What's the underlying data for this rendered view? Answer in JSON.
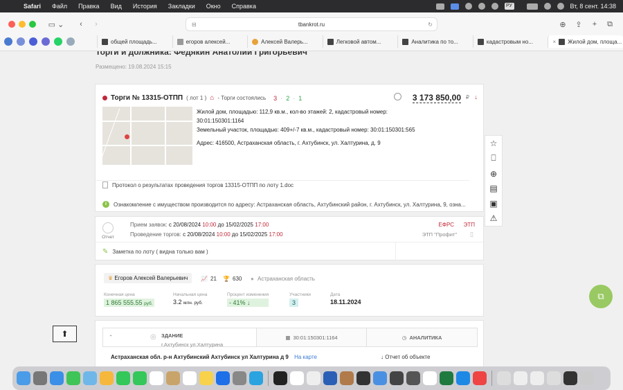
{
  "menubar": {
    "app": "Safari",
    "items": [
      "Файл",
      "Правка",
      "Вид",
      "История",
      "Закладки",
      "Окно",
      "Справка"
    ],
    "keyboard": "РУ",
    "datetime": "Вт, 8 сент.  14:38"
  },
  "browser": {
    "url": "tbankrot.ru",
    "tabs": [
      {
        "label": "общей площадь..."
      },
      {
        "label": "егоров алексей..."
      },
      {
        "label": "Алексей Валерь..."
      },
      {
        "label": "Легковой автом..."
      },
      {
        "label": "Аналитика по то..."
      },
      {
        "label": "кадастровым но..."
      },
      {
        "label": "Жилой дом, площа..."
      }
    ]
  },
  "page": {
    "title": "Торги и должника: Федякин Анатолий Григорьевич",
    "posted": "Размещено: 19.08.2024 15:15",
    "lot": {
      "number": "Торги № 13315-ОТПП",
      "lot_count": "( лот 1 )",
      "status": "- Торги состоялись",
      "stat1": "3",
      "stat2": "2",
      "stat3": "1",
      "sep": "·",
      "price": "3 173 850,00",
      "currency": "₽",
      "desc1": "Жилой дом, площадью: 112,9 кв.м., кол-во этажей: 2, кадастровый номер: 30:01:150301:1164",
      "desc2": "Земельный участок, площадью: 409+/-7 кв.м., кадастровый номер: 30:01:150301:565",
      "address": "Адрес: 416500, Астраханская область, г. Ахтубинск, ул. Халтурина, д. 9",
      "protocol": "Протокол о результатах проведения торгов 13315-ОТПП по лоту 1.doc",
      "info": "Ознакомление с имуществом производится по адресу: Астраханская область, Ахтубинский район, г. Ахтубинск, ул. Халтурина, 9, озна..."
    },
    "schedule": {
      "report": "Отчет",
      "accept_label": "Прием заявок:",
      "accept_from": "с 20/08/2024",
      "accept_from_time": "10:00",
      "accept_to": "до 15/02/2025",
      "accept_to_time": "17:00",
      "hold_label": "Проведение торгов:",
      "hold_from": "с 20/08/2024",
      "hold_from_time": "10:00",
      "hold_to": "до 15/02/2025",
      "hold_to_time": "17:00",
      "efrs": "ЕФРС",
      "etp": "ЭТП",
      "platform": "ЭТП \"Профит\"",
      "note": "Заметка по лоту ( видна только вам )"
    },
    "debtor": {
      "name": "Егоров Алексей Валерьевич",
      "count1": "21",
      "count2": "630",
      "region": "Астраханская область",
      "final_label": "Конечная цена",
      "final_value": "1 865 555.55",
      "final_unit": "руб.",
      "start_label": "Начальная цена",
      "start_value": "3.2",
      "start_unit": "млн. руб.",
      "change_label": "Процент изменения",
      "change_value": "- 41%",
      "participants_label": "Участники",
      "participants_value": "3",
      "date_label": "Дата",
      "date_value": "18.11.2024"
    },
    "object": {
      "tab1_title": "ЗДАНИЕ",
      "tab1_sub": "г.Ахтубинск ул.Халтурина",
      "tab2": "30:01:150301:1164",
      "tab3": "АНАЛИТИКА",
      "address": "Астраханская обл. р-н Ахтубинский Ахтубинск ул Халтурина д 9",
      "on_map": "На карте",
      "report": "Отчет об объекте"
    }
  },
  "icons": {
    "up": "arrow-up-icon",
    "fab": "copy-icon"
  },
  "colors": {
    "accent_red": "#c0283a",
    "accent_green": "#8bc34a"
  }
}
